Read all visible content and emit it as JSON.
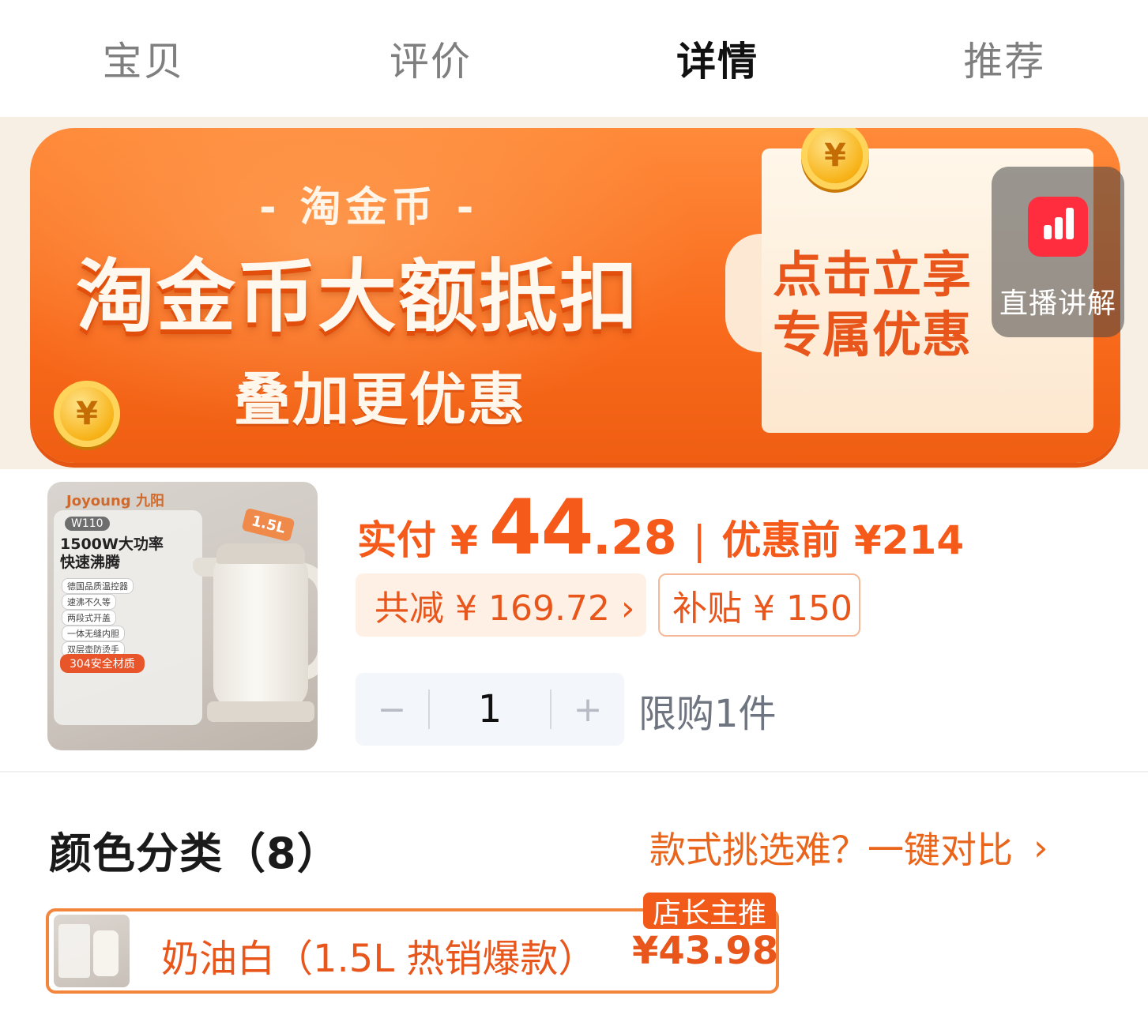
{
  "tabs": [
    {
      "label": "宝贝",
      "active": false
    },
    {
      "label": "评价",
      "active": false
    },
    {
      "label": "详情",
      "active": true
    },
    {
      "label": "推荐",
      "active": false
    }
  ],
  "banner": {
    "subtitle": "- 淘金币 -",
    "title": "淘金币大额抵扣",
    "desc": "叠加更优惠",
    "cta_line1": "点击立享",
    "cta_line2": "专属优惠",
    "coin_glyph": "¥"
  },
  "live": {
    "label": "直播讲解",
    "icon": "live-chart-icon",
    "color": "#ff2d3d"
  },
  "product": {
    "thumbnail": {
      "brand": "Joyoung 九阳",
      "model": "W110",
      "headline_1": "1500W大功率",
      "headline_2": "快速沸腾",
      "features": [
        "德国品质温控器",
        "速沸不久等",
        "两段式开盖",
        "一体无缝内胆",
        "双层壶防烫手"
      ],
      "material": "304安全材质",
      "capacity": "1.5L"
    },
    "price_label": "实付",
    "currency": "¥",
    "price_int": "44",
    "price_dec": ".28",
    "divider": "|",
    "original_price": "优惠前 ¥214",
    "reduce_chip": "共减 ¥ 169.72 ›",
    "subsidy_chip": "补贴 ¥ 150",
    "quantity": "1",
    "minus": "−",
    "plus": "+",
    "limit_text": "限购1件",
    "accent_color": "#f55a1a"
  },
  "colors": {
    "header": "颜色分类（8）",
    "compare_text": "款式挑选难？一键对比",
    "compare_chevron": "›",
    "variants": [
      {
        "name": "奶油白（1.5L 热销爆款）",
        "price": "¥43.98",
        "tag": "店长主推",
        "selected": true
      }
    ]
  }
}
